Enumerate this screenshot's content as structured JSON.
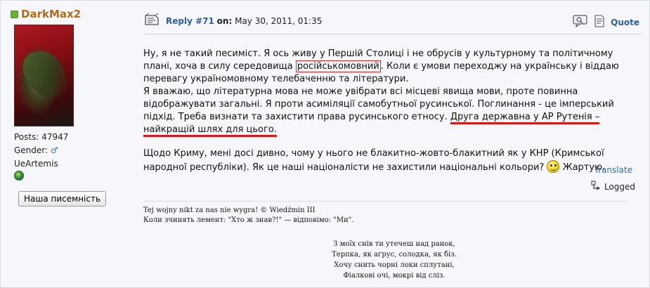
{
  "author": {
    "name": "DarkMax2",
    "posts_label": "Posts: 47947",
    "gender_label": "Gender:",
    "gender_symbol": "♂",
    "custom_field": "UeArtemis",
    "button_label": "Наша писемність"
  },
  "header": {
    "reply_label": "Reply #71",
    "on_label": "on:",
    "date": "May 30, 2011, 01:35",
    "quote_label": "Quote"
  },
  "body": {
    "p1_a": "Ну, я не такий песиміст. Я ось живу у Першій Столиці і не обрусів у культурному та політичному плані, хоча в силу середовища ",
    "p1_boxed": "російськомовний",
    "p1_b": ". Коли є умови переходжу на українську і віддаю перевагу україномовному телебаченню та літератури.",
    "p2_a": "Я вважаю, що літературна мова не може увібрати всі місцеві явища мови, проте повинна відображувати загальні. Я проти асиміляції самобутньої русинської. Поглинання - це імперський підхід. Треба визнати та захистити права русинського етносу. ",
    "p2_underlined": "Друга державна у АР Рутенія – найкращій шлях для цього.",
    "p3_a": "Щодо Криму, мені досі дивно, чому у нього не блакитно-жовто-блакитний як у КНР (Кримської народної республіки). Як це наші націоналісти не захистили національні кольори?",
    "p3_b": "Жартую."
  },
  "translate_label": "Translate",
  "logged_label": "Logged",
  "signature": {
    "line1": "Tej wojny nikt za nas nie wygra! © Wiedźmin III",
    "line2": "Коли зчинять лемент: \"Хто ж знав?!\" — відповімо: \"Ми\".",
    "poem": [
      "З моїх снів ти утечеш над ранок,",
      "Терпка, як аґрус, солодка, як біз.",
      "Хочу снить чорні локи сплутані,",
      "Фіалкові очі, мокрі від сліз."
    ]
  },
  "colors": {
    "author_name": "#b26a16",
    "link": "#2c5f9e",
    "highlight_red": "#d81818"
  }
}
